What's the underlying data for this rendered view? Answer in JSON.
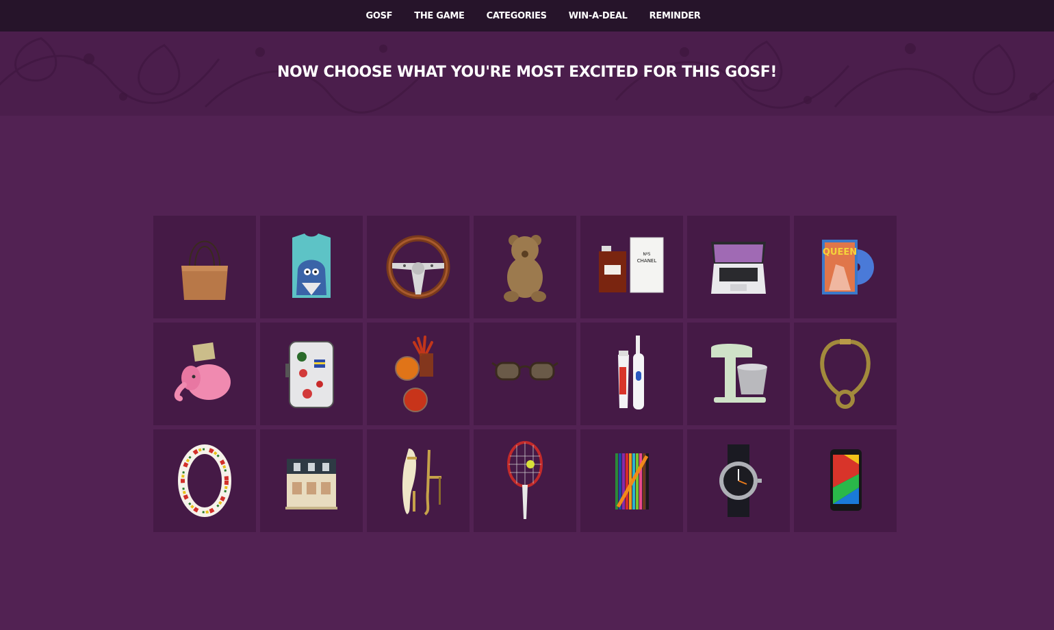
{
  "nav": {
    "items": [
      {
        "label": "GOSF"
      },
      {
        "label": "THE GAME"
      },
      {
        "label": "CATEGORIES"
      },
      {
        "label": "WIN-A-DEAL"
      },
      {
        "label": "REMINDER"
      }
    ]
  },
  "hero": {
    "title": "NOW CHOOSE WHAT YOU'RE MOST EXCITED FOR THIS GOSF!"
  },
  "products": [
    {
      "icon": "handbag-icon"
    },
    {
      "icon": "tshirt-icon"
    },
    {
      "icon": "steering-wheel-icon"
    },
    {
      "icon": "teddy-bear-icon"
    },
    {
      "icon": "perfume-icon",
      "text": "CHANEL"
    },
    {
      "icon": "laptop-icon"
    },
    {
      "icon": "movie-dvd-icon",
      "text": "QUEEN"
    },
    {
      "icon": "piggy-bank-icon"
    },
    {
      "icon": "suitcase-icon"
    },
    {
      "icon": "spices-icon"
    },
    {
      "icon": "sunglasses-icon"
    },
    {
      "icon": "toothbrush-toothpaste-icon"
    },
    {
      "icon": "stand-mixer-icon"
    },
    {
      "icon": "necklace-icon"
    },
    {
      "icon": "flower-garland-icon"
    },
    {
      "icon": "dollhouse-icon"
    },
    {
      "icon": "sandals-icon"
    },
    {
      "icon": "tennis-racket-icon"
    },
    {
      "icon": "colored-pencils-icon"
    },
    {
      "icon": "wristwatch-icon"
    },
    {
      "icon": "smartphone-icon"
    }
  ],
  "colors": {
    "background": "#522253",
    "nav_background": "#26142a",
    "hero_background": "#4b1e4c",
    "tile_background": "#451a46"
  }
}
